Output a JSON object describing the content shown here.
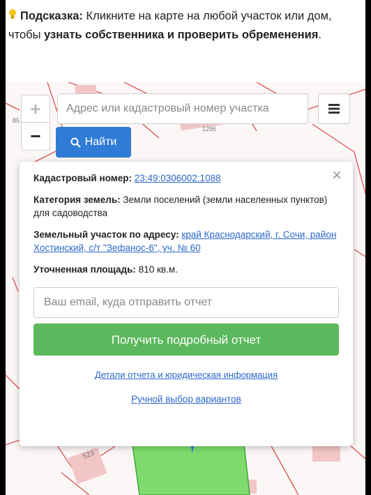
{
  "tip": {
    "label": "Подсказка:",
    "text1": "Кликните на карте на любой участок или дом, чтобы ",
    "bold": "узнать собственника и проверить обременения",
    "end": "."
  },
  "map": {
    "zoom_in": "+",
    "zoom_out": "−",
    "search_placeholder": "Адрес или кадастровый номер участка",
    "find_label": "Найти",
    "labels": {
      "num1295": "1295",
      "num85": "85",
      "num523": "523"
    }
  },
  "popup": {
    "close": "×",
    "cad_label": "Кадастровый номер:",
    "cad_value": "23:49:0306002:1088",
    "cat_label": "Категория земель:",
    "cat_value": "Земли поселений (земли населенных пунктов)",
    "purpose": "для садоводства",
    "addr_label": "Земельный участок по адресу:",
    "addr_value": "край Краснодарский, г. Сочи, район Хостинский, с/т \"Зефанос-6\", уч. № 60",
    "area_label": "Уточненная площадь:",
    "area_value": "810 кв.м.",
    "email_placeholder": "Ваш email, куда отправить отчет",
    "report_button": "Получить подробный отчет",
    "details_link": "Детали отчета и юридическая информация",
    "manual_link": "Ручной выбор вариантов"
  },
  "colors": {
    "accent_blue": "#2f7bd6",
    "report_green": "#5cb85c",
    "link": "#2a67c9",
    "parcel_line": "#d9534f"
  }
}
